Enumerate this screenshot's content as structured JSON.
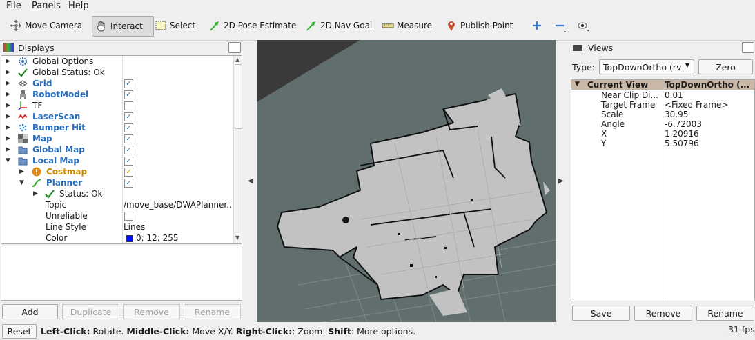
{
  "menu": {
    "file": "File",
    "panels": "Panels",
    "help": "Help"
  },
  "toolbar": {
    "move_camera": "Move Camera",
    "interact": "Interact",
    "select": "Select",
    "pose_estimate": "2D Pose Estimate",
    "nav_goal": "2D Nav Goal",
    "measure": "Measure",
    "publish_point": "Publish Point"
  },
  "displays": {
    "title": "Displays",
    "items": [
      {
        "label": "Global Options"
      },
      {
        "label": "Global Status: Ok"
      },
      {
        "label": "Grid"
      },
      {
        "label": "RobotModel"
      },
      {
        "label": "TF"
      },
      {
        "label": "LaserScan"
      },
      {
        "label": "Bumper Hit"
      },
      {
        "label": "Map"
      },
      {
        "label": "Global Map"
      },
      {
        "label": "Local Map"
      },
      {
        "label": "Costmap"
      },
      {
        "label": "Planner"
      },
      {
        "label": "Status: Ok"
      },
      {
        "label": "Topic",
        "value": "/move_base/DWAPlanner.."
      },
      {
        "label": "Unreliable"
      },
      {
        "label": "Line Style",
        "value": "Lines"
      },
      {
        "label": "Color",
        "value": "0; 12; 255"
      }
    ],
    "check_mark": "✓",
    "color_swatch": "#000cff",
    "buttons": {
      "add": "Add",
      "duplicate": "Duplicate",
      "remove": "Remove",
      "rename": "Rename"
    }
  },
  "views": {
    "title": "Views",
    "type_label": "Type:",
    "type_value": "TopDownOrtho (rv",
    "zero": "Zero",
    "header": {
      "name": "Current View",
      "value": "TopDownOrtho (..."
    },
    "props": [
      {
        "name": "Near Clip Di...",
        "value": "0.01"
      },
      {
        "name": "Target Frame",
        "value": "<Fixed Frame>"
      },
      {
        "name": "Scale",
        "value": "30.95"
      },
      {
        "name": "Angle",
        "value": "-6.72003"
      },
      {
        "name": "X",
        "value": "1.20916"
      },
      {
        "name": "Y",
        "value": "5.50796"
      }
    ],
    "buttons": {
      "save": "Save",
      "remove": "Remove",
      "rename": "Rename"
    }
  },
  "status": {
    "reset": "Reset",
    "h1_key": "Left-Click:",
    "h1_val": " Rotate. ",
    "h2_key": "Middle-Click:",
    "h2_val": " Move X/Y. ",
    "h3_key": "Right-Click:",
    "h3_val": ": Zoom. ",
    "h4_key": "Shift",
    "h4_val": ": More options.",
    "fps": "31 fps"
  },
  "colors": {
    "accent": "#2b6fbd",
    "warning": "#c88a00",
    "viewport_bg": "#606f6e",
    "map_free": "#c2c2c2"
  }
}
